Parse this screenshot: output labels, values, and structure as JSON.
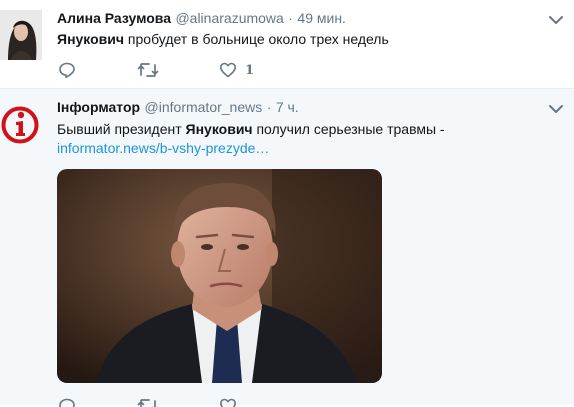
{
  "tweets": [
    {
      "author_name": "Алина Разумова",
      "handle": "@alinarazumowa",
      "separator": "·",
      "time": "49 мин.",
      "text_bold": "Янукович",
      "text_rest": " пробудет в больнице около трех недель",
      "likes": "1",
      "icons": [
        "avatar-photo",
        "chevron-down-icon",
        "reply-icon",
        "retweet-icon",
        "heart-icon"
      ]
    },
    {
      "author_name": "Інформатор",
      "handle": "@informator_news",
      "separator": "·",
      "time": "7 ч.",
      "text_pre": "Бывший президент ",
      "text_bold": "Янукович",
      "text_post": " получил серьезные травмы -",
      "link": "informator.news/b-vshy-prezyde…",
      "icons": [
        "informator-logo",
        "chevron-down-icon",
        "photo",
        "reply-icon",
        "retweet-icon",
        "heart-icon"
      ]
    }
  ],
  "colors": {
    "text": "#14171a",
    "secondary": "#657786",
    "link": "#1b95e0",
    "logo_red": "#d0121a",
    "hover_bg": "#f5f8fa"
  }
}
